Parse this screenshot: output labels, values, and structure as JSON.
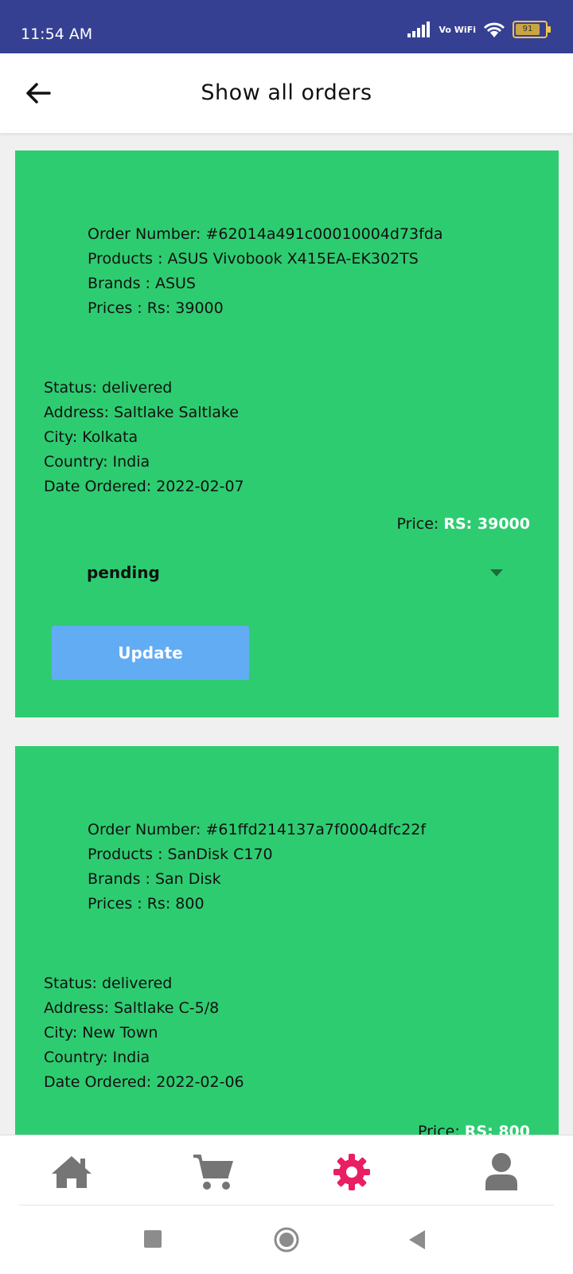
{
  "status_bar": {
    "time": "11:54 AM",
    "network": "Vo WiFi",
    "battery": "91"
  },
  "app_bar": {
    "title": "Show all orders"
  },
  "orders": [
    {
      "order_number": "Order Number: #62014a491c00010004d73fda",
      "products": "Products : ASUS Vivobook X415EA-EK302TS",
      "brands": "Brands : ASUS",
      "prices": "Prices : Rs: 39000",
      "status": "Status: delivered",
      "address": "Address: Saltlake Saltlake",
      "city": "City: Kolkata",
      "country": "Country: India",
      "date": "Date Ordered: 2022-02-07",
      "price_label": "Price:",
      "price_value": "RS: 39000",
      "dropdown_value": "pending",
      "update_label": "Update"
    },
    {
      "order_number": "Order Number: #61ffd214137a7f0004dfc22f",
      "products": "Products : SanDisk C170",
      "brands": "Brands : San Disk",
      "prices": "Prices : Rs: 800",
      "status": "Status: delivered",
      "address": "Address: Saltlake C-5/8",
      "city": "City: New Town",
      "country": "Country: India",
      "date": "Date Ordered: 2022-02-06",
      "price_label": "Price:",
      "price_value": "RS: 800"
    }
  ],
  "bottom_nav": {
    "items": [
      "home-icon",
      "cart-icon",
      "settings-icon",
      "profile-icon"
    ],
    "active": "settings-icon",
    "active_color": "#e91e63",
    "inactive_color": "#757575"
  },
  "colors": {
    "status_bar": "#354093",
    "card": "#2ecc71",
    "button": "#62acf4"
  }
}
